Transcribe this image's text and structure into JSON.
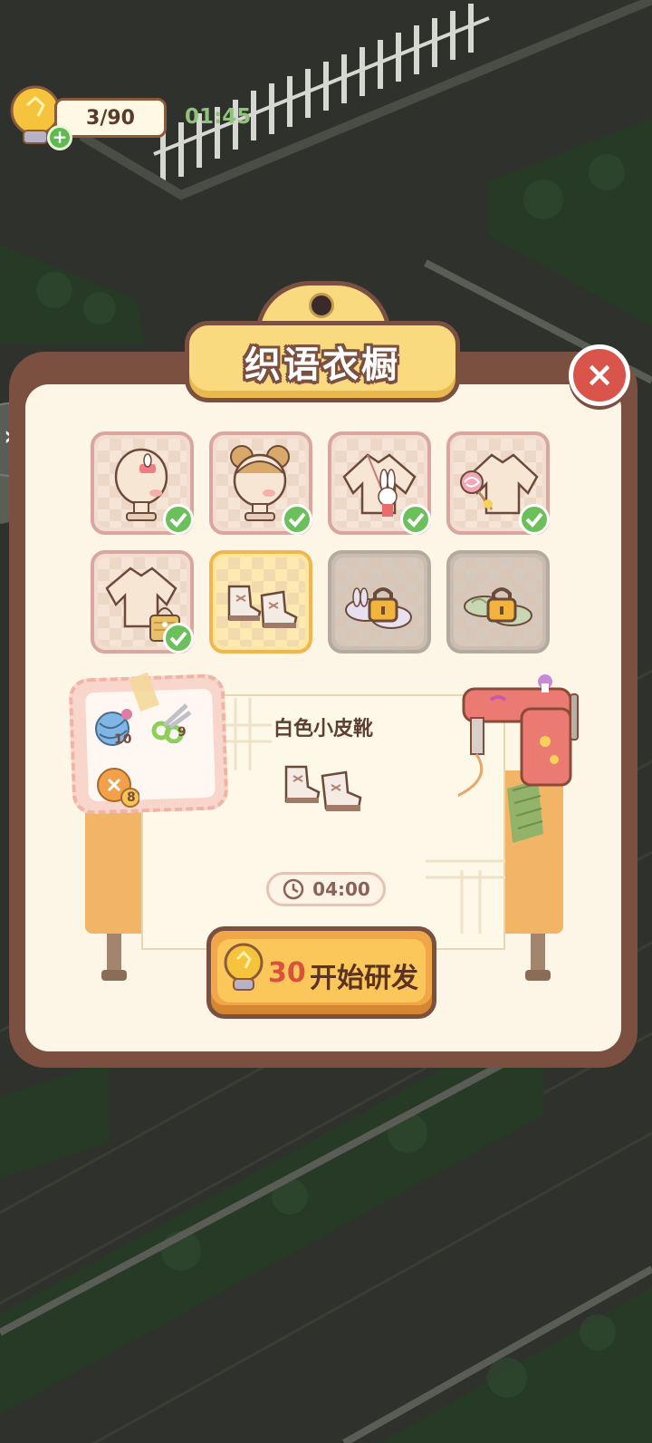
{
  "hud": {
    "energy": "3/90",
    "timer": "01:45",
    "plus": "+"
  },
  "panel": {
    "title": "织语衣橱",
    "close": "×"
  },
  "items": [
    {
      "name": "rabbit hair clip",
      "state": "owned"
    },
    {
      "name": "bun hairstyle",
      "state": "owned"
    },
    {
      "name": "rabbit bag",
      "state": "owned"
    },
    {
      "name": "lollipop",
      "state": "owned"
    },
    {
      "name": "basket",
      "state": "owned"
    },
    {
      "name": "white boots",
      "state": "selected"
    },
    {
      "name": "bunny slippers",
      "state": "locked"
    },
    {
      "name": "green shoes",
      "state": "locked"
    }
  ],
  "workbench": {
    "item_name": "白色小皮靴",
    "duration": "04:00",
    "materials": [
      {
        "icon": "yarn-ball-icon",
        "count": "10"
      },
      {
        "icon": "scissors-icon",
        "count": "9"
      },
      {
        "icon": "button-icon",
        "count": "8"
      }
    ]
  },
  "start_button": {
    "cost": "30",
    "label": "开始研发"
  },
  "colors": {
    "panel_border": "#7b5040",
    "panel_bg": "#fdf6e6",
    "plaque": "#f9da7e",
    "close": "#d9544a",
    "button": "#fbc65a",
    "check": "#6bc05b",
    "timer_text": "#8fc27a"
  }
}
